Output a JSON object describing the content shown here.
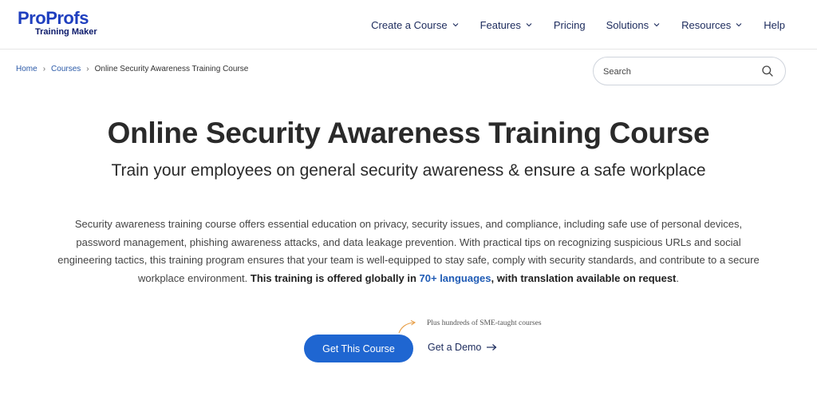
{
  "header": {
    "logo": {
      "pro": "Pro",
      "profs": "Profs",
      "sub": "Training Maker"
    },
    "nav": [
      {
        "label": "Create a Course",
        "dropdown": true
      },
      {
        "label": "Features",
        "dropdown": true
      },
      {
        "label": "Pricing",
        "dropdown": false
      },
      {
        "label": "Solutions",
        "dropdown": true
      },
      {
        "label": "Resources",
        "dropdown": true
      },
      {
        "label": "Help",
        "dropdown": false
      }
    ]
  },
  "breadcrumb": {
    "home": "Home",
    "courses": "Courses",
    "current": "Online Security Awareness Training Course"
  },
  "search": {
    "placeholder": "Search"
  },
  "hero": {
    "title": "Online Security Awareness Training Course",
    "subtitle": "Train your employees on general security awareness & ensure a safe workplace",
    "desc_plain": "Security awareness training course offers essential education on privacy, security issues, and compliance, including safe use of personal devices, password management, phishing awareness attacks, and data leakage prevention. With practical tips on recognizing suspicious URLs and social engineering tactics, this training program ensures that your team is well-equipped to stay safe, comply with security standards, and contribute to a secure workplace environment. ",
    "desc_bold_a": "This training is offered globally in ",
    "desc_lang": "70+ languages",
    "desc_bold_b": ", with translation available on request",
    "desc_end": "."
  },
  "cta": {
    "note": "Plus hundreds of SME-taught courses",
    "primary_label": "Get This Course",
    "demo_label": "Get a Demo"
  },
  "colors": {
    "accent": "#1f66d1",
    "nav_text": "#1b2a5c",
    "note_arrow": "#e8a04a"
  }
}
